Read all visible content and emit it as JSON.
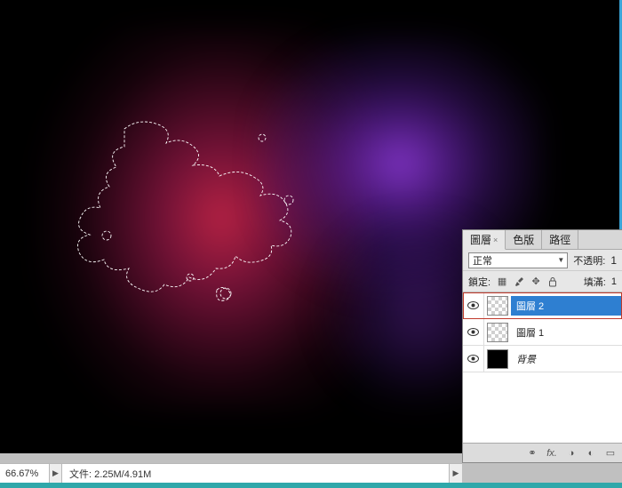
{
  "status": {
    "zoom": "66.67%",
    "doc_info": "文件: 2.25M/4.91M"
  },
  "panel": {
    "tabs": {
      "layers": "圖層",
      "channels": "色版",
      "paths": "路徑"
    },
    "blend_mode": "正常",
    "opacity_label": "不透明:",
    "opacity_value": "1",
    "lock_label": "鎖定:",
    "fill_label": "填滿:",
    "fill_value": "1",
    "layers": [
      {
        "name": "圖層 2",
        "thumb": "checker",
        "selected": true
      },
      {
        "name": "圖層 1",
        "thumb": "checker",
        "selected": false
      },
      {
        "name": "背景",
        "thumb": "black",
        "selected": false,
        "bg": true
      }
    ]
  }
}
